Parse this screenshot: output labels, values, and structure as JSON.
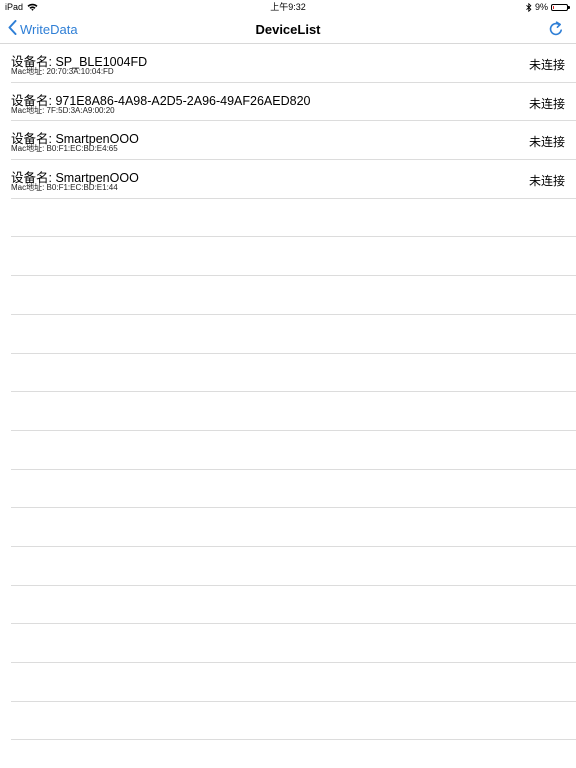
{
  "status_bar": {
    "device": "iPad",
    "time": "上午9:32",
    "battery": "9%",
    "battery_level": 0.09,
    "battery_color": "#e02020"
  },
  "nav": {
    "back_label": "WriteData",
    "title": "DeviceList",
    "accent_color": "#2f7fd6",
    "refresh_icon": "refresh-icon"
  },
  "devices": [
    {
      "name": "设备名: SP_BLE1004FD",
      "mac": "Mac地址: 20:70:3A:10:04:FD",
      "status": "未连接"
    },
    {
      "name": "设备名: 971E8A86-4A98-A2D5-2A96-49AF26AED820",
      "mac": "Mac地址: 7F:5D:3A:A9:00:20",
      "status": "未连接"
    },
    {
      "name": "设备名: SmartpenOOO",
      "mac": "Mac地址: B0:F1:EC:BD:E4:65",
      "status": "未连接"
    },
    {
      "name": "设备名: SmartpenOOO",
      "mac": "Mac地址: B0:F1:EC:BD:E1:44",
      "status": "未连接"
    }
  ]
}
